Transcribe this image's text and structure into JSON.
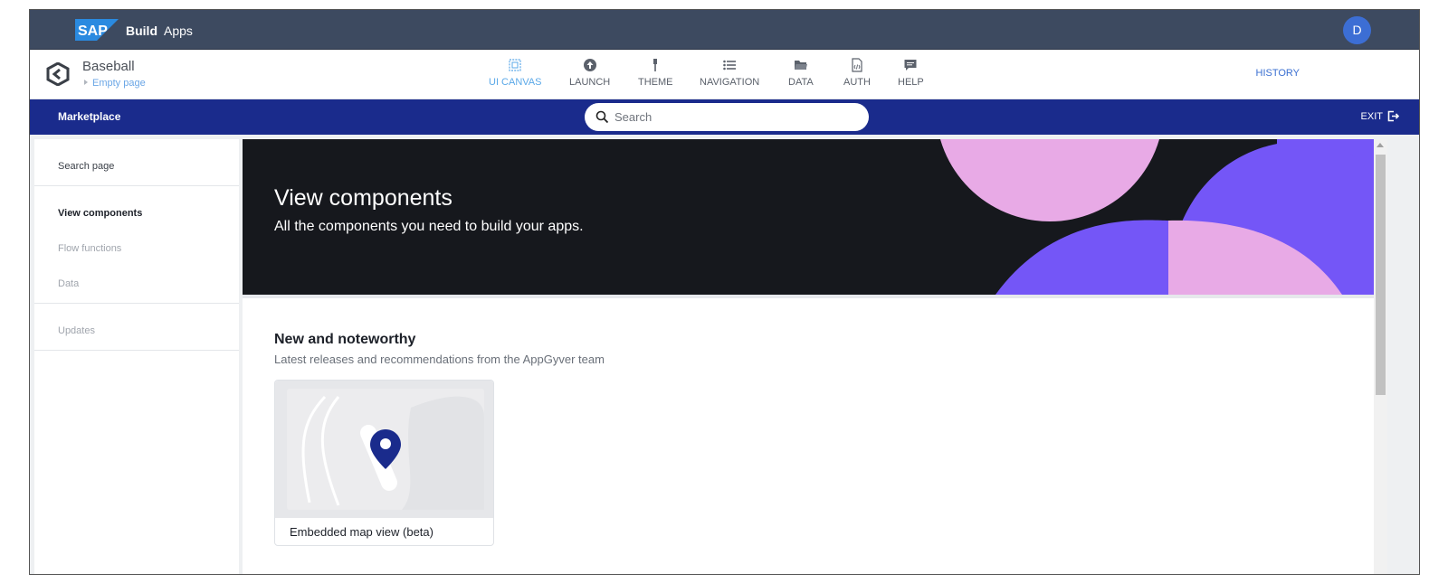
{
  "shell": {
    "brand_logo": "SAP",
    "brand_build": "Build",
    "brand_apps": "Apps",
    "avatar_initial": "D"
  },
  "app": {
    "name": "Baseball",
    "page": "Empty page",
    "tabs": [
      {
        "label": "UI CANVAS",
        "icon": "canvas-icon",
        "active": true
      },
      {
        "label": "LAUNCH",
        "icon": "launch-icon",
        "active": false
      },
      {
        "label": "THEME",
        "icon": "theme-icon",
        "active": false
      },
      {
        "label": "NAVIGATION",
        "icon": "navigation-icon",
        "active": false
      },
      {
        "label": "DATA",
        "icon": "folder-icon",
        "active": false
      },
      {
        "label": "AUTH",
        "icon": "auth-icon",
        "active": false
      },
      {
        "label": "HELP",
        "icon": "help-icon",
        "active": false
      }
    ],
    "history": "HISTORY"
  },
  "marketplace": {
    "title": "Marketplace",
    "search_placeholder": "Search",
    "exit": "EXIT"
  },
  "sidebar": {
    "items": [
      {
        "label": "Search page",
        "state": "normal"
      },
      {
        "label": "View components",
        "state": "active"
      },
      {
        "label": "Flow functions",
        "state": "muted"
      },
      {
        "label": "Data",
        "state": "muted"
      },
      {
        "label": "Updates",
        "state": "muted"
      }
    ]
  },
  "hero": {
    "title": "View components",
    "subtitle": "All the components you need to build your apps."
  },
  "section": {
    "title": "New and noteworthy",
    "subtitle": "Latest releases and recommendations from the AppGyver team",
    "cards": [
      {
        "label": "Embedded map view (beta)",
        "icon": "map-pin-icon"
      }
    ]
  },
  "colors": {
    "shellbar": "#3d4a60",
    "marketplace_bar": "#1a2b8c",
    "active_tab": "#5aa8e8",
    "hero_bg": "#16181d",
    "hero_pink": "#e8aae6",
    "hero_purple": "#7456f7"
  }
}
